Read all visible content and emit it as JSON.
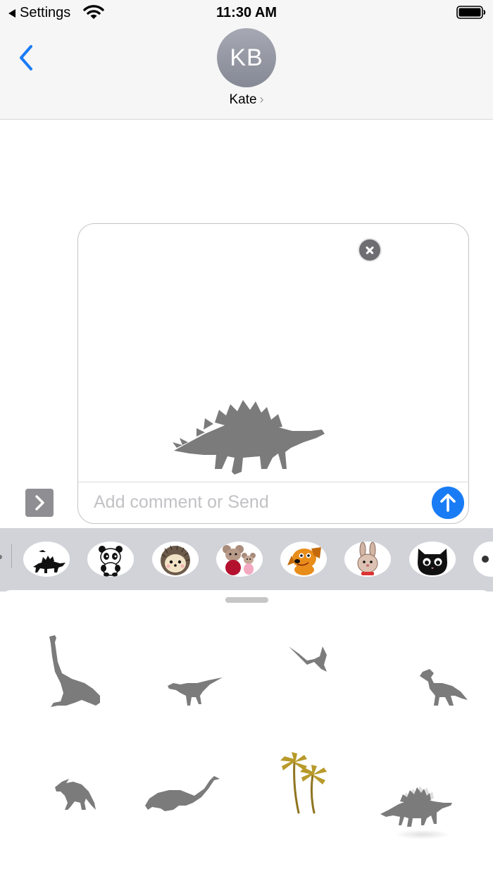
{
  "status_bar": {
    "back_app": "Settings",
    "time": "11:30 AM"
  },
  "header": {
    "avatar_initials": "KB",
    "contact_name": "Kate",
    "contact_chevron": "›"
  },
  "compose": {
    "comment_placeholder": "Add comment or Send"
  },
  "app_strip": {
    "apps": [
      {
        "name": "dinosaur-stickers"
      },
      {
        "name": "panda-stickers"
      },
      {
        "name": "hedgehog-stickers"
      },
      {
        "name": "mice-stickers"
      },
      {
        "name": "dog-stickers"
      },
      {
        "name": "bunny-stickers"
      },
      {
        "name": "cat-stickers"
      }
    ]
  },
  "colors": {
    "accent_blue": "#1a7cf5",
    "sticker_gray": "#7b7b7b",
    "palm_gold": "#b89a2a",
    "strip_bg": "#d1d3d9"
  },
  "stickers": [
    {
      "name": "brachiosaurus-sticker"
    },
    {
      "name": "iguanodon-sticker"
    },
    {
      "name": "pterodactyl-sticker"
    },
    {
      "name": "t-rex-sticker"
    },
    {
      "name": "parasaurolophus-sticker"
    },
    {
      "name": "plesiosaur-sticker"
    },
    {
      "name": "palm-trees-sticker"
    },
    {
      "name": "stegosaurus-sticker"
    }
  ]
}
